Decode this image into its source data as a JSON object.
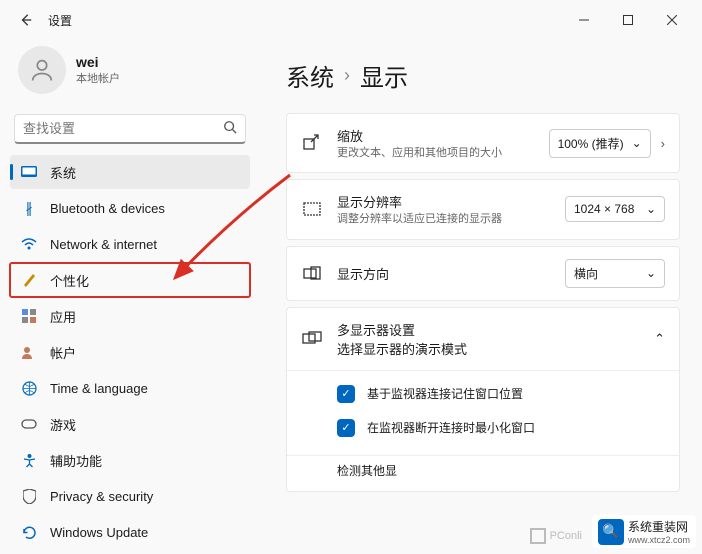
{
  "app": {
    "title": "设置"
  },
  "account": {
    "name": "wei",
    "type": "本地帐户"
  },
  "search": {
    "placeholder": "查找设置"
  },
  "nav": [
    {
      "key": "system",
      "label": "系统",
      "icon_color": "#0067c0"
    },
    {
      "key": "bluetooth",
      "label": "Bluetooth & devices",
      "icon_color": "#0067c0"
    },
    {
      "key": "network",
      "label": "Network & internet",
      "icon_color": "#0067c0"
    },
    {
      "key": "personalization",
      "label": "个性化",
      "icon_color": "#ca8a04"
    },
    {
      "key": "apps",
      "label": "应用",
      "icon_color": "#555"
    },
    {
      "key": "accounts",
      "label": "帐户",
      "icon_color": "#c17a5b"
    },
    {
      "key": "time",
      "label": "Time & language",
      "icon_color": "#0067c0"
    },
    {
      "key": "gaming",
      "label": "游戏",
      "icon_color": "#555"
    },
    {
      "key": "accessibility",
      "label": "辅助功能",
      "icon_color": "#0067c0"
    },
    {
      "key": "privacy",
      "label": "Privacy & security",
      "icon_color": "#555"
    },
    {
      "key": "update",
      "label": "Windows Update",
      "icon_color": "#0067c0"
    }
  ],
  "breadcrumb": {
    "parent": "系统",
    "current": "显示"
  },
  "settings": {
    "scale": {
      "title": "缩放",
      "desc": "更改文本、应用和其他项目的大小",
      "value": "100% (推荐)"
    },
    "resolution": {
      "title": "显示分辨率",
      "desc": "调整分辨率以适应已连接的显示器",
      "value": "1024 × 768"
    },
    "orientation": {
      "title": "显示方向",
      "value": "横向"
    },
    "multi": {
      "title": "多显示器设置",
      "desc": "选择显示器的演示模式",
      "opt1": "基于监视器连接记住窗口位置",
      "opt2": "在监视器断开连接时最小化窗口",
      "detect": "检测其他显"
    }
  },
  "watermarks": {
    "pconline": "PConli",
    "site_name": "系统重装网",
    "site_url": "www.xtcz2.com"
  }
}
